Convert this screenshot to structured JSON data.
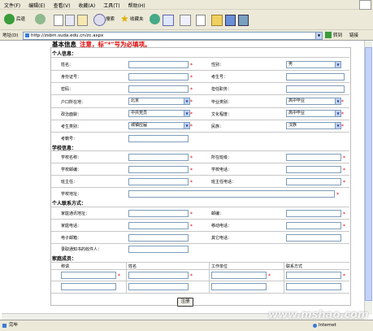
{
  "menu": [
    "文件(F)",
    "编辑(E)",
    "查看(V)",
    "收藏(A)",
    "工具(T)",
    "帮助(H)"
  ],
  "toolbar": {
    "back": "后退",
    "search": "搜索",
    "favorites": "收藏夹"
  },
  "address": {
    "label": "地址(D)",
    "url": "http://zsbm.suda.edu.cn/zc.aspx",
    "go": "转到",
    "links": "链接"
  },
  "form": {
    "title": "基本信息",
    "note": "注意，标“*”号为必填项。",
    "sections": {
      "personal": "个人信息：",
      "school": "学校信息：",
      "contact": "个人联系方式：",
      "family": "家庭成员："
    },
    "personal": {
      "name": "姓名：",
      "gender": "性别：",
      "gender_value": "男",
      "id_no": "身份证号：",
      "exam_no": "考生号：",
      "password": "密码：",
      "guardian": "担任职务：",
      "hukou": "户口所在地：",
      "hukou_value": "北京",
      "grad_type": "毕业类别：",
      "grad_value": "高中毕业",
      "politics": "政治面貌：",
      "politics_value": "中共党员",
      "culture": "文化程度：",
      "culture_value": "高中毕业",
      "student_type": "考生类别：",
      "student_type_value": "城镇应届",
      "ethnicity": "民族：",
      "ethnicity_value": "汉族",
      "exam_num": "考籍号："
    },
    "school": {
      "school_name": "学校名称：",
      "class": "所在班级：",
      "school_zip": "学校邮编：",
      "school_phone": "学校电话：",
      "head_teacher": "班主任：",
      "teacher_phone": "班主任电话：",
      "school_addr": "学校地址："
    },
    "contact": {
      "home_addr": "家庭通讯地址：",
      "zip": "邮编：",
      "home_phone": "家庭电话：",
      "mobile": "移动电话：",
      "email": "电子邮箱：",
      "other_phone": "其它电话：",
      "receiver": "录取通知书的收件人："
    },
    "family": {
      "cols": [
        "称谓",
        "姓名",
        "工作单位",
        "联系方式"
      ]
    },
    "submit": "注册"
  },
  "status": {
    "left": "完毕",
    "right": "Internet"
  },
  "watermark": "www.mshao.com"
}
